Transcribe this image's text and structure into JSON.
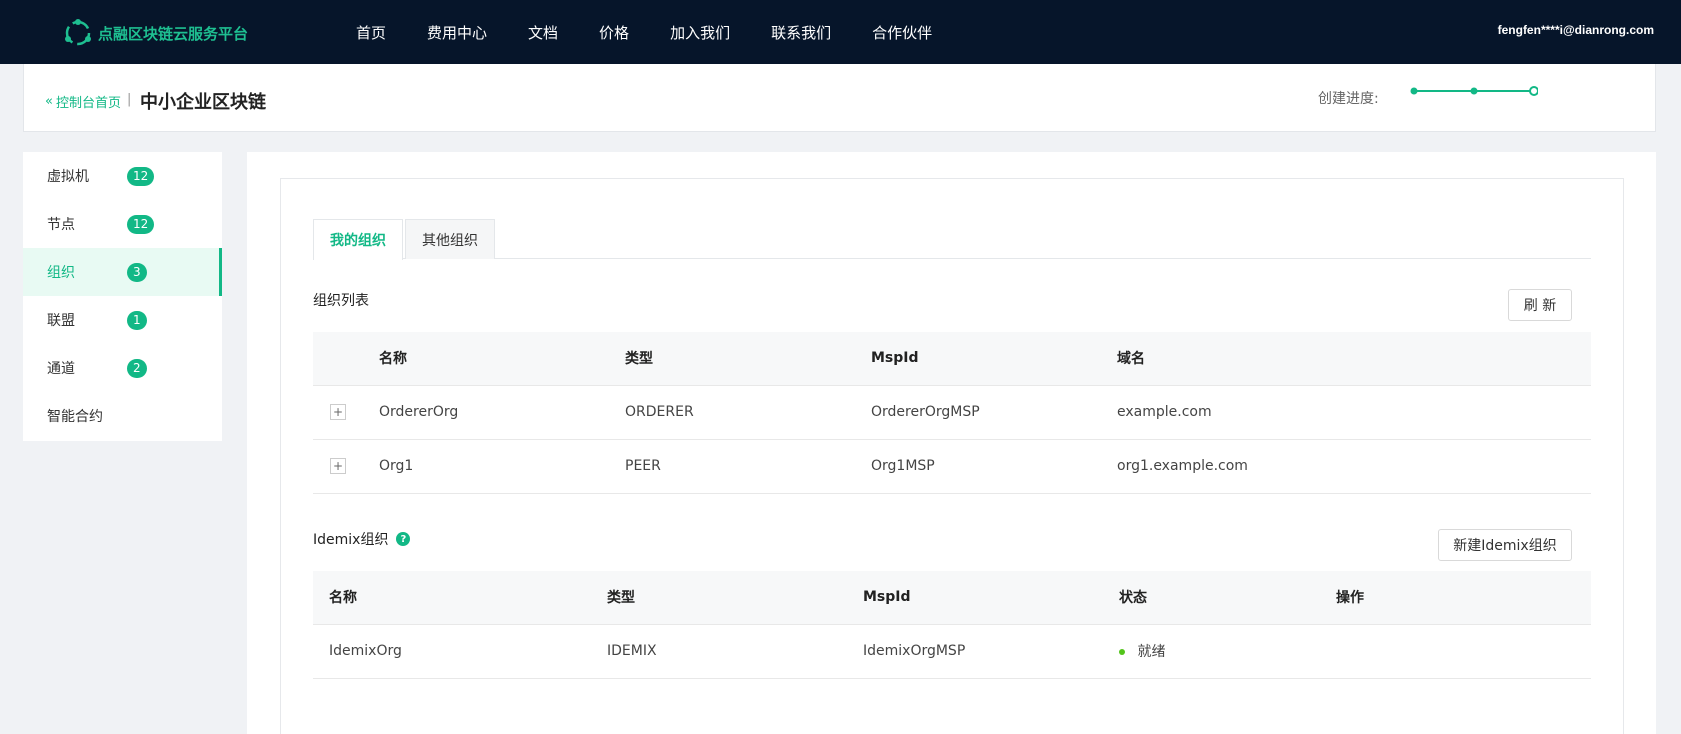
{
  "nav": {
    "brand": "点融区块链云服务平台",
    "items": [
      "首页",
      "费用中心",
      "文档",
      "价格",
      "加入我们",
      "联系我们",
      "合作伙伴"
    ],
    "user": "fengfen****i@dianrong.com"
  },
  "header": {
    "back_label": "控制台首页",
    "separator": "|",
    "title": "中小企业区块链",
    "progress_label": "创建进度:",
    "progress_steps_done": 3,
    "progress_steps_total": 3
  },
  "sidebar": {
    "items": [
      {
        "label": "虚拟机",
        "count": "12"
      },
      {
        "label": "节点",
        "count": "12"
      },
      {
        "label": "组织",
        "count": "3",
        "active": true
      },
      {
        "label": "联盟",
        "count": "1"
      },
      {
        "label": "通道",
        "count": "2"
      },
      {
        "label": "智能合约",
        "count": ""
      }
    ]
  },
  "tabs": [
    "我的组织",
    "其他组织"
  ],
  "org_list": {
    "title": "组织列表",
    "refresh_label": "刷 新",
    "headers": [
      "名称",
      "类型",
      "MspId",
      "域名"
    ],
    "rows": [
      {
        "name": "OrdererOrg",
        "type": "ORDERER",
        "mspid": "OrdererOrgMSP",
        "domain": "example.com"
      },
      {
        "name": "Org1",
        "type": "PEER",
        "mspid": "Org1MSP",
        "domain": "org1.example.com"
      }
    ]
  },
  "idemix": {
    "title": "Idemix组织",
    "help_icon": "?",
    "new_label": "新建Idemix组织",
    "headers": [
      "名称",
      "类型",
      "MspId",
      "状态",
      "操作"
    ],
    "rows": [
      {
        "name": "IdemixOrg",
        "type": "IDEMIX",
        "mspid": "IdemixOrgMSP",
        "status": "就绪",
        "action": ""
      }
    ]
  },
  "colors": {
    "accent": "#12b886",
    "topbar": "#06152a",
    "status_ready": "#52c41a"
  },
  "icons": {
    "logo": "brand-logo-icon",
    "back": "double-chevron-left-icon",
    "expand": "plus-icon",
    "help": "question-circle-icon"
  }
}
